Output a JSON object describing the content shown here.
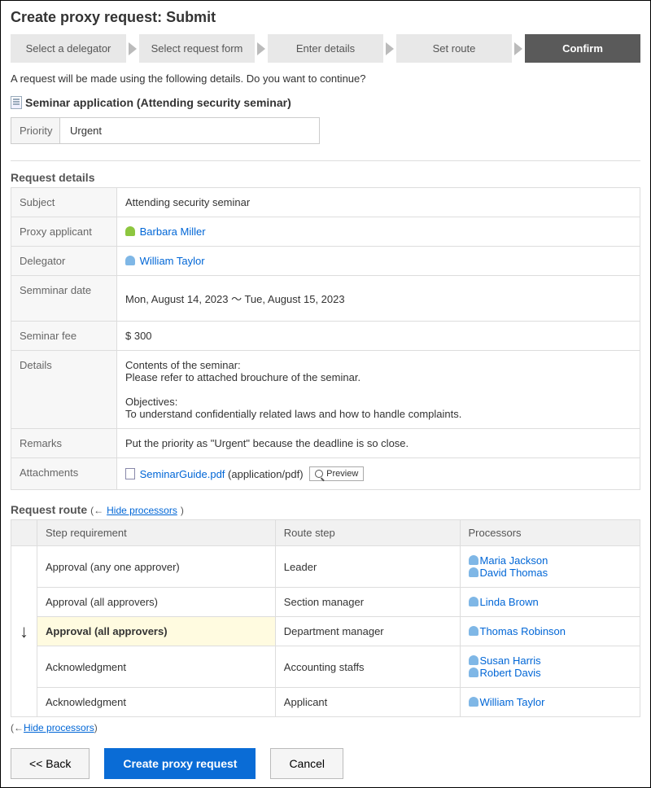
{
  "page_title": "Create proxy request: Submit",
  "steps": [
    "Select a delegator",
    "Select request form",
    "Enter details",
    "Set route",
    "Confirm"
  ],
  "active_step_index": 4,
  "intro_text": "A request will be made using the following details. Do you want to continue?",
  "form_name": "Seminar application (Attending security seminar)",
  "priority": {
    "label": "Priority",
    "value": "Urgent"
  },
  "request_details_title": "Request details",
  "details": {
    "subject_label": "Subject",
    "subject": "Attending security seminar",
    "proxy_label": "Proxy applicant",
    "proxy_name": "Barbara Miller",
    "delegator_label": "Delegator",
    "delegator_name": "William Taylor",
    "semdate_label": "Semminar date",
    "semdate_value": "Mon, August 14, 2023 ～  Tue, August 15, 2023",
    "fee_label": "Seminar fee",
    "fee_value": "$ 300",
    "details_label": "Details",
    "details_line1": "Contents of the seminar:",
    "details_line2": "Please refer to attached brouchure of the seminar.",
    "details_line3": "Objectives:",
    "details_line4": "To understand confidentially related laws and how to handle complaints.",
    "remarks_label": "Remarks",
    "remarks_value": "Put the priority as \"Urgent\" because the deadline is so close.",
    "attach_label": "Attachments",
    "attach_name": "SeminarGuide.pdf",
    "attach_type": "(application/pdf)",
    "preview_label": "Preview"
  },
  "route": {
    "title": "Request route",
    "hide_link": "Hide processors",
    "hide_link_bottom": "Hide processors",
    "headers": {
      "step": "Step requirement",
      "route": "Route step",
      "proc": "Processors"
    },
    "rows": [
      {
        "req": "Approval (any one approver)",
        "step": "Leader",
        "proc": [
          "Maria Jackson",
          "David Thomas"
        ]
      },
      {
        "req": "Approval (all approvers)",
        "step": "Section manager",
        "proc": [
          "Linda Brown"
        ]
      },
      {
        "req": "Approval (all approvers)",
        "step": "Department manager",
        "proc": [
          "Thomas Robinson"
        ],
        "highlight": true
      },
      {
        "req": "Acknowledgment",
        "step": "Accounting staffs",
        "proc": [
          "Susan Harris",
          "Robert Davis"
        ]
      },
      {
        "req": "Acknowledgment",
        "step": "Applicant",
        "proc": [
          "William Taylor"
        ]
      }
    ]
  },
  "buttons": {
    "back": "<< Back",
    "create": "Create proxy request",
    "cancel": "Cancel"
  }
}
